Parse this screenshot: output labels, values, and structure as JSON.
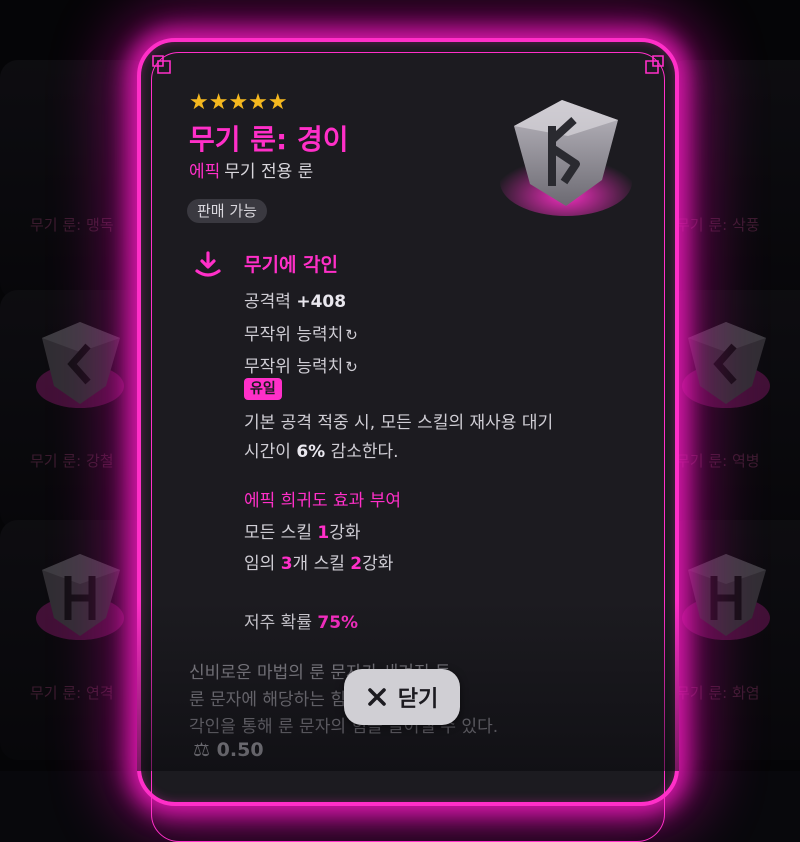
{
  "background_items": [
    {
      "label": "무기 룬: 맹독"
    },
    {
      "label": "무기 룬: 삭풍"
    },
    {
      "label": "무기 룬: 강철"
    },
    {
      "label": "무기 룬: 역병"
    },
    {
      "label": "무기 룬: 연격"
    },
    {
      "label": "무기 룬: 화염"
    }
  ],
  "item": {
    "stars": "★★★★★",
    "star_count": 5,
    "name": "무기 룬: 경이",
    "rarity": "에픽",
    "type": "무기 전용 룬",
    "sell_badge": "판매 가능",
    "engrave": {
      "title": "무기에 각인",
      "attack_label": "공격력",
      "attack_value": "+408",
      "random_stat_1": "무작위 능력치",
      "random_stat_2": "무작위 능력치",
      "unique_badge": "유일",
      "effect_line1": "기본 공격 적중 시, 모든 스킬의 재사용 대기",
      "effect_line2_pre": "시간이",
      "effect_line2_value": "6%",
      "effect_line2_post": "감소한다."
    },
    "epic_bonus": {
      "title": "에픽 희귀도 효과 부여",
      "line1_pre": "모든 스킬",
      "line1_value": "1",
      "line1_post": "강화",
      "line2_pre": "임의",
      "line2_value1": "3",
      "line2_mid": "개 스킬",
      "line2_value2": "2",
      "line2_post": "강화"
    },
    "curse": {
      "label": "저주 확률",
      "value": "75%"
    },
    "lore": [
      "신비로운 마법의 룬 문자가 새겨진 돌.",
      "룬 문자에 해당하는 힘이 담겨 있다.",
      "각인을 통해 룬 문자의 힘을 끌어낼 수 있다."
    ],
    "weight": "0.50"
  },
  "close_button": {
    "label": "닫기"
  },
  "colors": {
    "accent": "#ff2fc8",
    "star": "#f5b81f",
    "panel": "#1c1b20"
  }
}
